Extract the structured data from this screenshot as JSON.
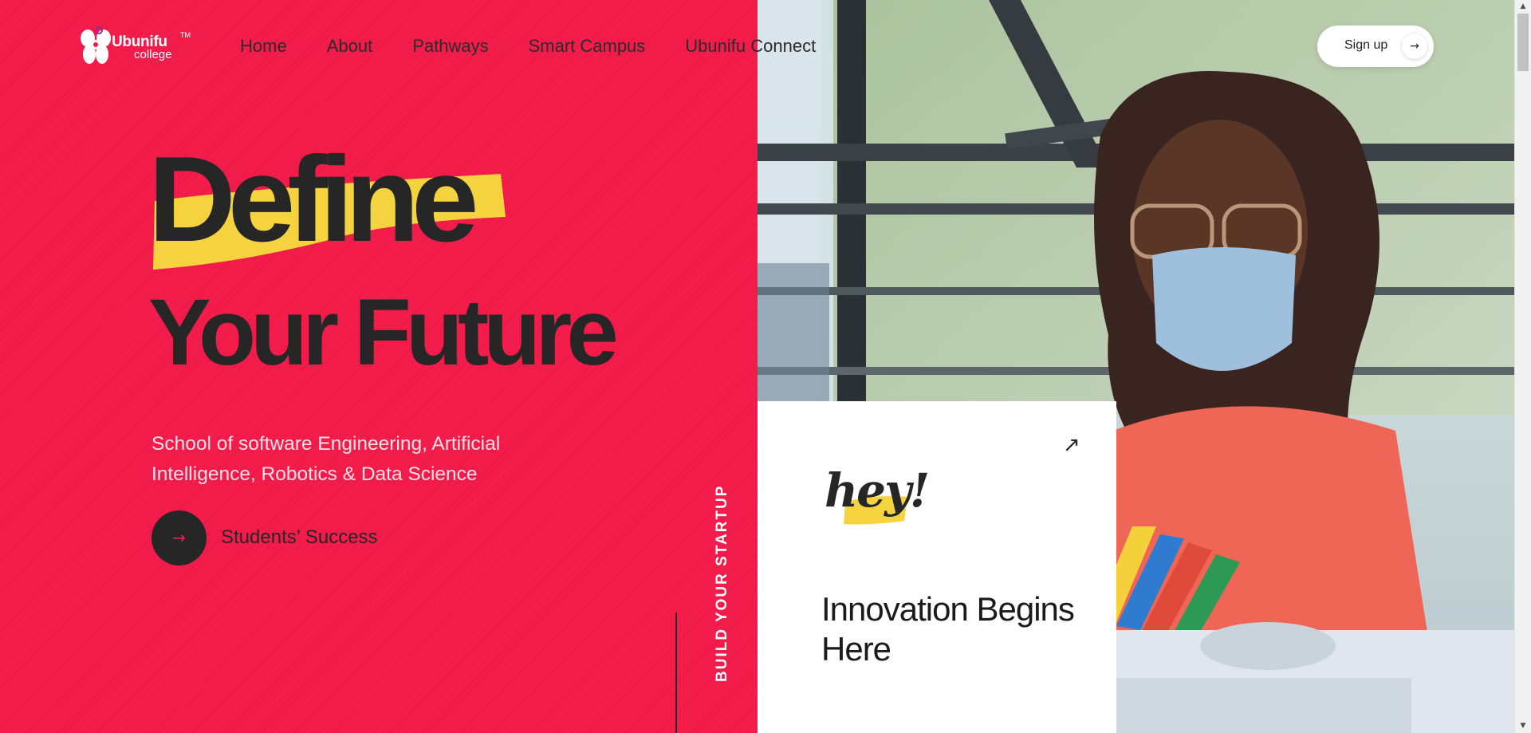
{
  "brand": {
    "name": "Ubunifu",
    "tm": "TM",
    "sub": "college"
  },
  "nav": {
    "items": [
      "Home",
      "About",
      "Pathways",
      "Smart Campus",
      "Ubunifu Connect"
    ]
  },
  "signup": {
    "label": "Sign up",
    "arrow": "→"
  },
  "hero": {
    "headline_1": "Define",
    "headline_2": "Your Future",
    "subtitle": "School of software Engineering, Artificial Intelligence, Robotics & Data Science",
    "cta_label": "Students’ Success",
    "cta_arrow": "→",
    "vertical_text": "BUILD YOUR STARTUP"
  },
  "card": {
    "arrow": "↗",
    "hey": "hey!",
    "title": "Innovation Begins Here"
  },
  "colors": {
    "hero_bg": "#f41c4b",
    "ink": "#262626",
    "highlight": "#f5d33f",
    "white": "#ffffff"
  },
  "icons": {
    "scroll_up": "▲",
    "scroll_down": "▼"
  }
}
